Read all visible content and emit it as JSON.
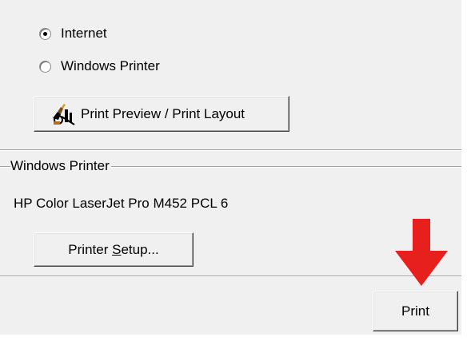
{
  "output_options": {
    "internet_label": "Internet",
    "internet_selected": true,
    "windows_printer_label": "Windows Printer",
    "windows_printer_selected": false,
    "print_preview_button_label": "Print Preview / Print Layout"
  },
  "windows_printer_group": {
    "title": "Windows Printer",
    "printer_name": "HP Color LaserJet Pro M452 PCL 6",
    "printer_setup_label_prefix": "Printer ",
    "printer_setup_label_accel": "S",
    "printer_setup_label_suffix": "etup..."
  },
  "footer": {
    "print_button_label": "Print"
  },
  "colors": {
    "arrow": "#e8201d",
    "window_background": "#f0f0f0"
  },
  "icons": {
    "print_preview": "print-preview-icon",
    "annotation_arrow": "red-arrow-down"
  }
}
